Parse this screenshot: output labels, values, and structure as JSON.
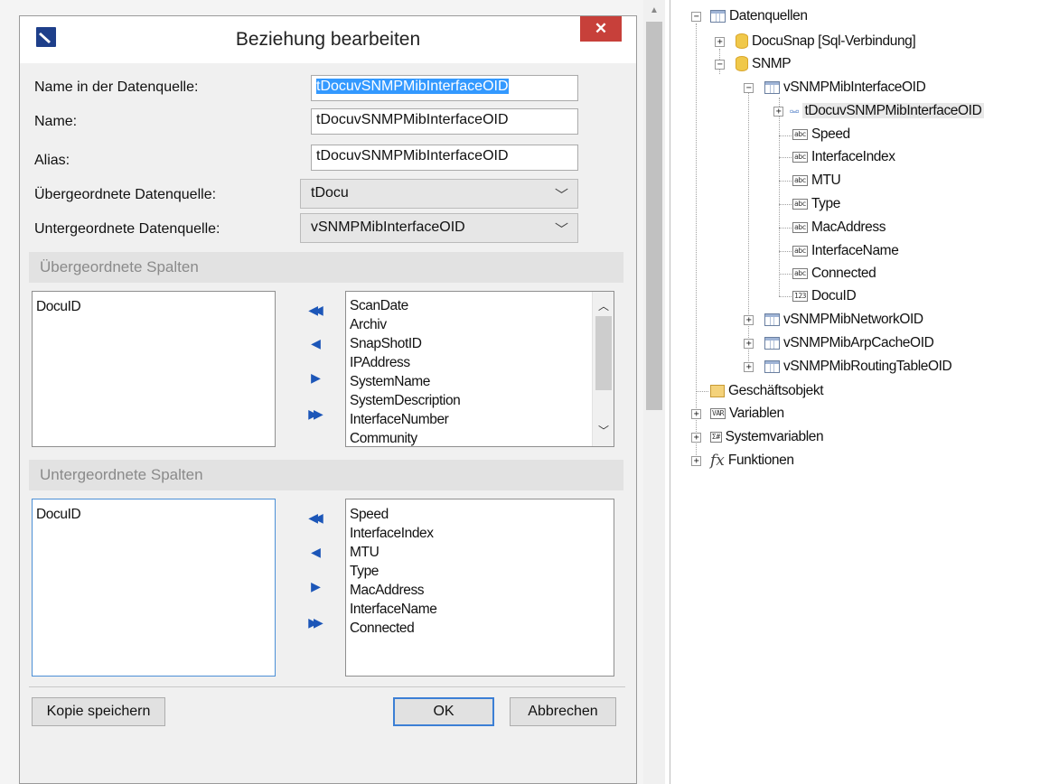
{
  "dialog": {
    "title": "Beziehung bearbeiten",
    "close_glyph": "✕",
    "fields": [
      {
        "label": "Name in der Datenquelle:",
        "value": "tDocuvSNMPMibInterfaceOID"
      },
      {
        "label": "Name:",
        "value": "tDocuvSNMPMibInterfaceOID"
      },
      {
        "label": "Alias:",
        "value": "tDocuvSNMPMibInterfaceOID"
      }
    ],
    "parent_source": {
      "label": "Übergeordnete Datenquelle:",
      "value": "tDocu"
    },
    "child_source": {
      "label": "Untergeordnete Datenquelle:",
      "value": "vSNMPMibInterfaceOID"
    },
    "parent_columns": {
      "header": "Übergeordnete Spalten",
      "selected": [
        "DocuID"
      ],
      "available": [
        "ScanDate",
        "Archiv",
        "SnapShotID",
        "IPAddress",
        "SystemName",
        "SystemDescription",
        "InterfaceNumber",
        "Community"
      ]
    },
    "child_columns": {
      "header": "Untergeordnete Spalten",
      "selected": [
        "DocuID"
      ],
      "available": [
        "Speed",
        "InterfaceIndex",
        "MTU",
        "Type",
        "MacAddress",
        "InterfaceName",
        "Connected"
      ]
    },
    "move_buttons": {
      "all_left": "◀◀",
      "one_left": "◀",
      "one_right": "▶",
      "all_right": "▶▶"
    },
    "buttons": {
      "save_copy": "Kopie speichern",
      "ok": "OK",
      "cancel": "Abbrechen"
    }
  },
  "tree": {
    "root": "Datenquellen",
    "connection": "DocuSnap [Sql-Verbindung]",
    "snmp": "SNMP",
    "table_main": "vSNMPMibInterfaceOID",
    "relation": "tDocuvSNMPMibInterfaceOID",
    "fields": [
      {
        "type": "abc",
        "name": "Speed"
      },
      {
        "type": "abc",
        "name": "InterfaceIndex"
      },
      {
        "type": "abc",
        "name": "MTU"
      },
      {
        "type": "abc",
        "name": "Type"
      },
      {
        "type": "abc",
        "name": "MacAddress"
      },
      {
        "type": "abc",
        "name": "InterfaceName"
      },
      {
        "type": "abc",
        "name": "Connected"
      },
      {
        "type": "123",
        "name": "DocuID"
      }
    ],
    "other_tables": [
      "vSNMPMibNetworkOID",
      "vSNMPMibArpCacheOID",
      "vSNMPMibRoutingTableOID"
    ],
    "business_object": "Geschäftsobjekt",
    "variables": {
      "badge": "VAR",
      "label": "Variablen"
    },
    "system_variables": {
      "badge": "Σ#",
      "label": "Systemvariablen"
    },
    "functions": {
      "badge": "fx",
      "label": "Funktionen"
    }
  },
  "colors": {
    "accent": "#1c56b8",
    "close": "#c7403a",
    "selection": "#3399ff"
  }
}
